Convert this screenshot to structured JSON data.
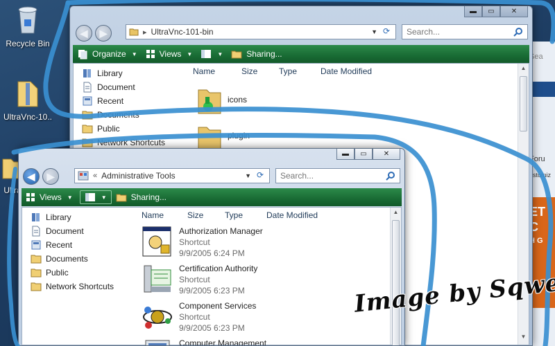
{
  "desktop": {
    "icons": [
      {
        "label": "Recycle Bin",
        "icon": "recycle-bin-icon"
      },
      {
        "label": "UltraVnc-10..",
        "icon": "zip-folder-icon"
      },
      {
        "label": "Ultra",
        "icon": "folder-icon"
      }
    ]
  },
  "background_app": {
    "search_label": "Sea",
    "texts": [
      "Foru",
      "ustomiz",
      "ET",
      "C",
      "H G"
    ]
  },
  "back_window": {
    "address_path": "UltraVnc-101-bin",
    "search_placeholder": "Search...",
    "toolbar": {
      "organize": "Organize",
      "views": "Views",
      "sharing": "Sharing..."
    },
    "nav_items": [
      {
        "label": "Library",
        "icon": "library-icon"
      },
      {
        "label": "Document",
        "icon": "document-icon"
      },
      {
        "label": "Recent",
        "icon": "recent-icon"
      },
      {
        "label": "Documents",
        "icon": "folder-icon"
      },
      {
        "label": "Public",
        "icon": "folder-icon"
      },
      {
        "label": "Network Shortcuts",
        "icon": "folder-icon"
      }
    ],
    "columns": [
      "Name",
      "Size",
      "Type",
      "Date Modified"
    ],
    "files": [
      {
        "name": "icons",
        "icon": "folder-icon"
      },
      {
        "name": "plugin",
        "icon": "folder-icon"
      }
    ]
  },
  "front_window": {
    "address_prefix": "«",
    "address_path": "Administrative Tools",
    "search_placeholder": "Search...",
    "toolbar": {
      "views": "Views",
      "sharing": "Sharing..."
    },
    "nav_items": [
      {
        "label": "Library",
        "icon": "library-icon"
      },
      {
        "label": "Document",
        "icon": "document-icon"
      },
      {
        "label": "Recent",
        "icon": "recent-icon"
      },
      {
        "label": "Documents",
        "icon": "folder-icon"
      },
      {
        "label": "Public",
        "icon": "folder-icon"
      },
      {
        "label": "Network Shortcuts",
        "icon": "folder-icon"
      }
    ],
    "columns": [
      "Name",
      "Size",
      "Type",
      "Date Modified"
    ],
    "files": [
      {
        "name": "Authorization Manager",
        "type": "Shortcut",
        "date": "9/9/2005 6:24 PM",
        "icon": "authorization-manager-icon"
      },
      {
        "name": "Certification Authority",
        "type": "Shortcut",
        "date": "9/9/2005 6:23 PM",
        "icon": "certification-authority-icon"
      },
      {
        "name": "Component Services",
        "type": "Shortcut",
        "date": "9/9/2005 6:23 PM",
        "icon": "component-services-icon"
      },
      {
        "name": "Computer Management",
        "type": "",
        "date": "",
        "icon": "computer-management-icon"
      }
    ]
  },
  "watermark": "Image by Sqweez",
  "colors": {
    "toolbar_green": "#196b34",
    "scribble_blue": "#3a8fd0",
    "titlebar": "#c5d4e6"
  }
}
